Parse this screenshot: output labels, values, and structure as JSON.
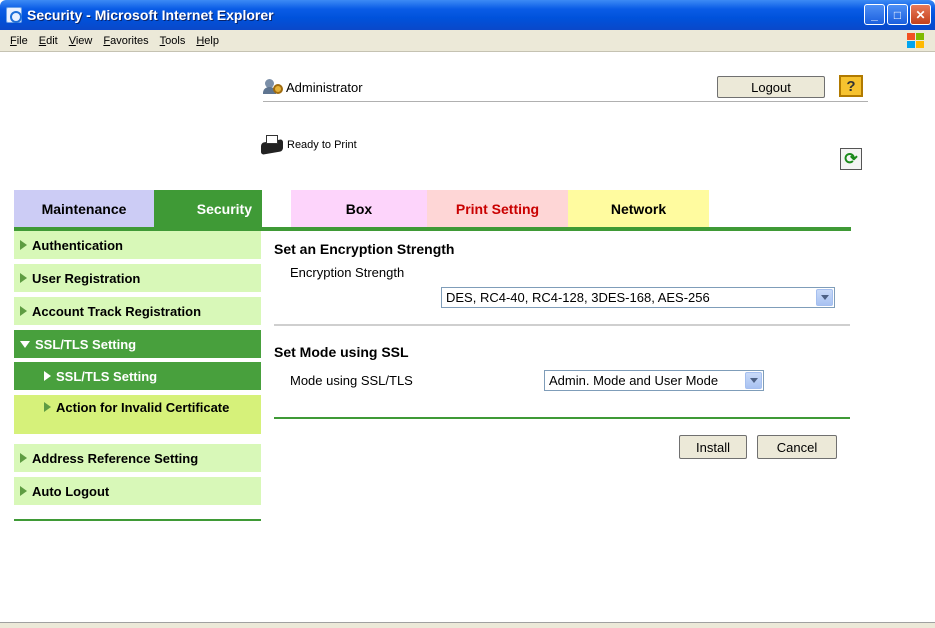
{
  "window": {
    "title": "Security - Microsoft Internet Explorer",
    "minimize": "_",
    "maximize": "□",
    "close": "✕"
  },
  "menu": {
    "items": [
      "File",
      "Edit",
      "View",
      "Favorites",
      "Tools",
      "Help"
    ]
  },
  "header": {
    "user": "Administrator",
    "logout_label": "Logout",
    "help_label": "?",
    "status": "Ready to Print",
    "refresh_icon": "refresh-icon"
  },
  "tabs": [
    {
      "label": "Maintenance"
    },
    {
      "label": "Security"
    },
    {
      "label": "Box"
    },
    {
      "label": "Print Setting"
    },
    {
      "label": "Network"
    }
  ],
  "sidebar": {
    "items": [
      {
        "label": "Authentication"
      },
      {
        "label": "User Registration"
      },
      {
        "label": "Account Track Registration"
      },
      {
        "label": "SSL/TLS Setting"
      },
      {
        "label": "SSL/TLS Setting"
      },
      {
        "label": "Action for Invalid Certificate"
      },
      {
        "label": "Address Reference Setting"
      },
      {
        "label": "Auto Logout"
      }
    ]
  },
  "main": {
    "encryption": {
      "title": "Set an Encryption Strength",
      "label": "Encryption Strength",
      "value": "DES, RC4-40, RC4-128, 3DES-168, AES-256"
    },
    "ssl_mode": {
      "title": "Set Mode using SSL",
      "label": "Mode using SSL/TLS",
      "value": "Admin. Mode and User Mode"
    },
    "install_label": "Install",
    "cancel_label": "Cancel"
  },
  "colors": {
    "security_green": "#3f9a36",
    "sidebar_light": "#d8f8b8",
    "xp_blue": "#0052db"
  }
}
